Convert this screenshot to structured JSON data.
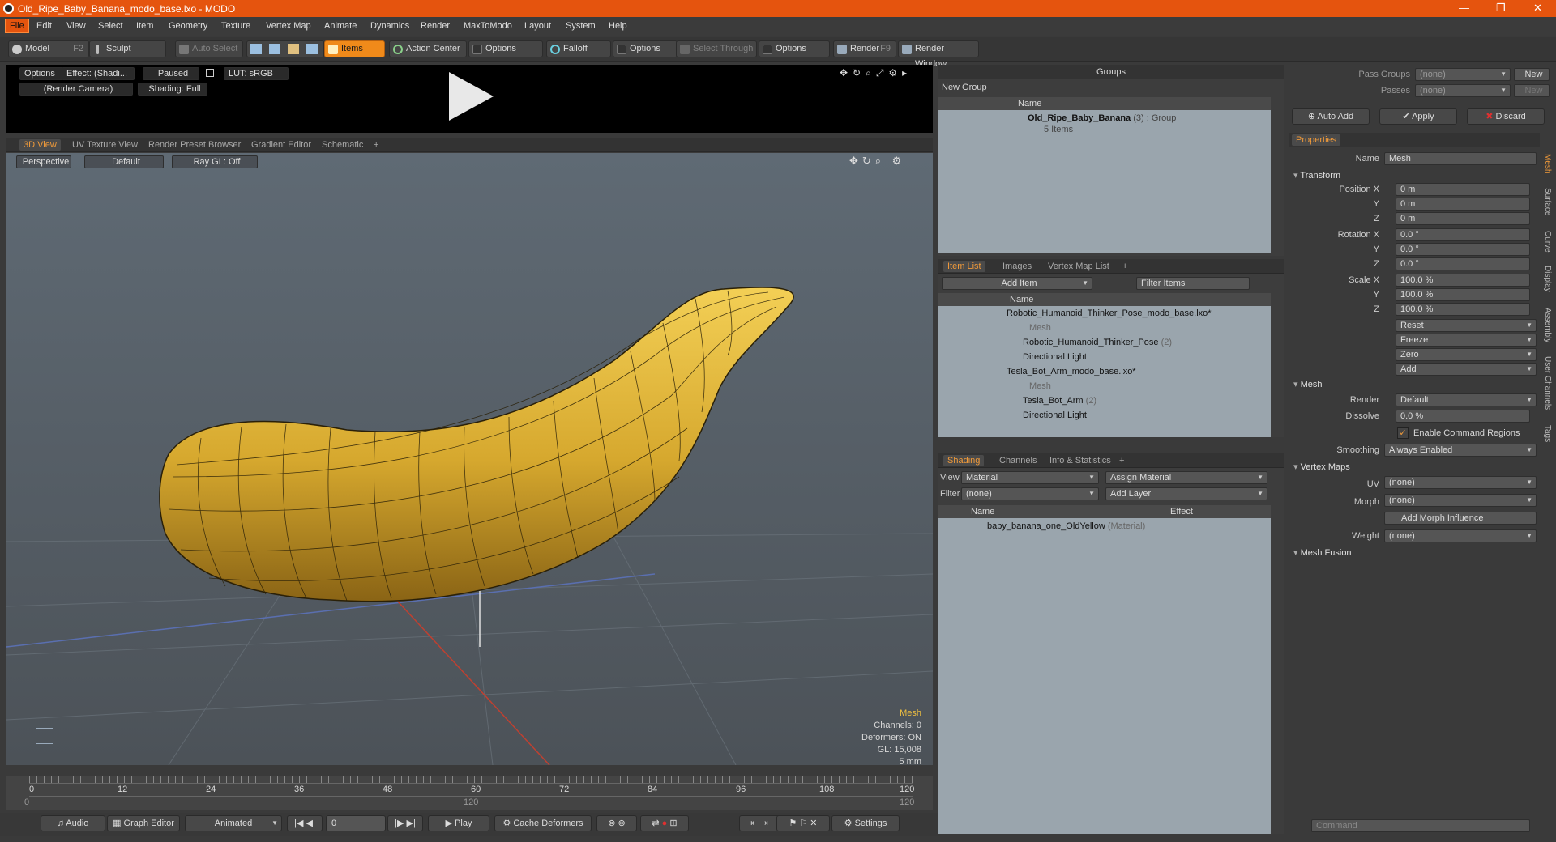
{
  "title": "Old_Ripe_Baby_Banana_modo_base.lxo - MODO",
  "menu": [
    "File",
    "Edit",
    "View",
    "Select",
    "Item",
    "Geometry",
    "Texture",
    "Vertex Map",
    "Animate",
    "Dynamics",
    "Render",
    "MaxToModo",
    "Layout",
    "System",
    "Help"
  ],
  "toolbar": {
    "model": "Model",
    "model_key": "F2",
    "sculpt": "Sculpt",
    "auto_select": "Auto Select",
    "items": "Items",
    "action_center": "Action Center",
    "options1": "Options",
    "falloff": "Falloff",
    "options2": "Options",
    "select_through": "Select Through",
    "options3": "Options",
    "render": "Render",
    "render_key": "F9",
    "render_window": "Render Window"
  },
  "preview": {
    "options": "Options",
    "effect": "Effect: (Shadi...",
    "paused": "Paused",
    "lut": "LUT: sRGB",
    "camera": "(Render Camera)",
    "shading": "Shading: Full"
  },
  "viewport_tabs": [
    "3D View",
    "UV Texture View",
    "Render Preset Browser",
    "Gradient Editor",
    "Schematic",
    "+"
  ],
  "viewport": {
    "perspective": "Perspective",
    "default": "Default",
    "raygl": "Ray GL: Off"
  },
  "stats": {
    "type": "Mesh",
    "channels": "Channels: 0",
    "deformers": "Deformers: ON",
    "gl": "GL: 15,008",
    "size": "5 mm"
  },
  "timeline": {
    "ticks": [
      "0",
      "12",
      "24",
      "36",
      "48",
      "60",
      "72",
      "84",
      "96",
      "108",
      "120"
    ],
    "sub": [
      "0",
      "120",
      "120"
    ]
  },
  "bottombar": {
    "audio": "Audio",
    "graph": "Graph Editor",
    "animated": "Animated",
    "frame": "0",
    "play": "Play",
    "cache": "Cache Deformers",
    "settings": "Settings"
  },
  "groups": {
    "title": "Groups",
    "new_group": "New Group",
    "col_name": "Name",
    "item_name": "Old_Ripe_Baby_Banana",
    "item_count": "(3)",
    "item_type": ": Group",
    "item_sub": "5 Items"
  },
  "itemlist": {
    "tabs": [
      "Item List",
      "Images",
      "Vertex Map List",
      "+"
    ],
    "add_item": "Add Item",
    "filter": "Filter Items",
    "col_name": "Name",
    "rows": [
      {
        "text": "Robotic_Humanoid_Thinker_Pose_modo_base.lxo*",
        "extra": ""
      },
      {
        "text": "Mesh",
        "extra": ""
      },
      {
        "text": "Robotic_Humanoid_Thinker_Pose",
        "extra": "(2)"
      },
      {
        "text": "Directional Light",
        "extra": ""
      },
      {
        "text": "Tesla_Bot_Arm_modo_base.lxo*",
        "extra": ""
      },
      {
        "text": "Mesh",
        "extra": ""
      },
      {
        "text": "Tesla_Bot_Arm",
        "extra": "(2)"
      },
      {
        "text": "Directional Light",
        "extra": ""
      }
    ]
  },
  "shading": {
    "tabs": [
      "Shading",
      "Channels",
      "Info & Statistics",
      "+"
    ],
    "view_label": "View",
    "view_value": "Material",
    "assign": "Assign Material",
    "filter_label": "Filter",
    "filter_value": "(none)",
    "add_layer": "Add Layer",
    "col_name": "Name",
    "col_effect": "Effect",
    "row": "baby_banana_one_OldYellow",
    "row_type": "(Material)"
  },
  "properties": {
    "pass_groups_label": "Pass Groups",
    "pass_groups": "(none)",
    "new": "New",
    "passes_label": "Passes",
    "passes": "(none)",
    "new2": "New",
    "auto_add": "Auto Add",
    "apply": "Apply",
    "discard": "Discard",
    "tab": "Properties",
    "name_label": "Name",
    "name_value": "Mesh",
    "transform": "Transform",
    "pos_x_label": "Position X",
    "pos_x": "0 m",
    "y": "Y",
    "pos_y": "0 m",
    "z": "Z",
    "pos_z": "0 m",
    "rot_x_label": "Rotation X",
    "rot_x": "0.0 °",
    "rot_y": "0.0 °",
    "rot_z": "0.0 °",
    "scale_x_label": "Scale X",
    "scale_x": "100.0 %",
    "scale_y": "100.0 %",
    "scale_z": "100.0 %",
    "reset": "Reset",
    "freeze": "Freeze",
    "zero": "Zero",
    "add": "Add",
    "mesh": "Mesh",
    "render_label": "Render",
    "render_value": "Default",
    "dissolve_label": "Dissolve",
    "dissolve_value": "0.0 %",
    "enable_regions": "Enable Command Regions",
    "smoothing_label": "Smoothing",
    "smoothing_value": "Always Enabled",
    "vertex_maps": "Vertex Maps",
    "uv_label": "UV",
    "uv_value": "(none)",
    "morph_label": "Morph",
    "morph_value": "(none)",
    "add_morph": "Add Morph Influence",
    "weight_label": "Weight",
    "weight_value": "(none)",
    "mesh_fusion": "Mesh Fusion",
    "side_tabs": [
      "Mesh",
      "Surface",
      "Curve",
      "Display",
      "Assembly",
      "User Channels",
      "Tags"
    ],
    "command": "Command"
  }
}
